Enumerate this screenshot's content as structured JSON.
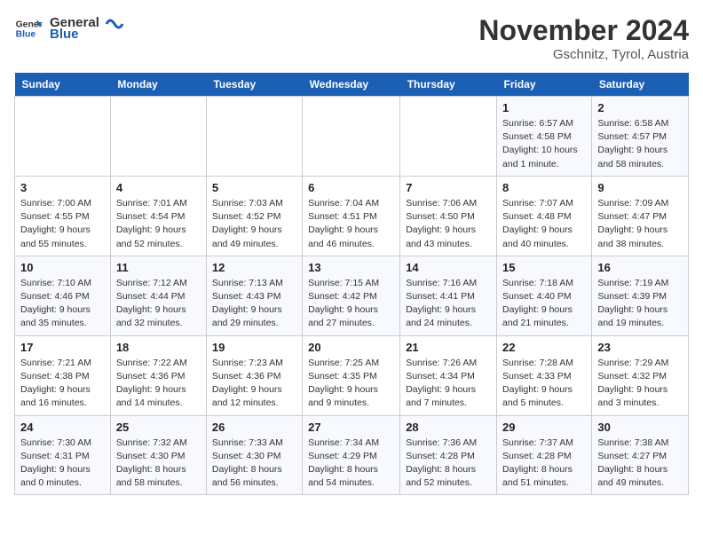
{
  "logo": {
    "text_general": "General",
    "text_blue": "Blue"
  },
  "title": "November 2024",
  "location": "Gschnitz, Tyrol, Austria",
  "weekdays": [
    "Sunday",
    "Monday",
    "Tuesday",
    "Wednesday",
    "Thursday",
    "Friday",
    "Saturday"
  ],
  "weeks": [
    [
      {
        "day": "",
        "info": ""
      },
      {
        "day": "",
        "info": ""
      },
      {
        "day": "",
        "info": ""
      },
      {
        "day": "",
        "info": ""
      },
      {
        "day": "",
        "info": ""
      },
      {
        "day": "1",
        "info": "Sunrise: 6:57 AM\nSunset: 4:58 PM\nDaylight: 10 hours and 1 minute."
      },
      {
        "day": "2",
        "info": "Sunrise: 6:58 AM\nSunset: 4:57 PM\nDaylight: 9 hours and 58 minutes."
      }
    ],
    [
      {
        "day": "3",
        "info": "Sunrise: 7:00 AM\nSunset: 4:55 PM\nDaylight: 9 hours and 55 minutes."
      },
      {
        "day": "4",
        "info": "Sunrise: 7:01 AM\nSunset: 4:54 PM\nDaylight: 9 hours and 52 minutes."
      },
      {
        "day": "5",
        "info": "Sunrise: 7:03 AM\nSunset: 4:52 PM\nDaylight: 9 hours and 49 minutes."
      },
      {
        "day": "6",
        "info": "Sunrise: 7:04 AM\nSunset: 4:51 PM\nDaylight: 9 hours and 46 minutes."
      },
      {
        "day": "7",
        "info": "Sunrise: 7:06 AM\nSunset: 4:50 PM\nDaylight: 9 hours and 43 minutes."
      },
      {
        "day": "8",
        "info": "Sunrise: 7:07 AM\nSunset: 4:48 PM\nDaylight: 9 hours and 40 minutes."
      },
      {
        "day": "9",
        "info": "Sunrise: 7:09 AM\nSunset: 4:47 PM\nDaylight: 9 hours and 38 minutes."
      }
    ],
    [
      {
        "day": "10",
        "info": "Sunrise: 7:10 AM\nSunset: 4:46 PM\nDaylight: 9 hours and 35 minutes."
      },
      {
        "day": "11",
        "info": "Sunrise: 7:12 AM\nSunset: 4:44 PM\nDaylight: 9 hours and 32 minutes."
      },
      {
        "day": "12",
        "info": "Sunrise: 7:13 AM\nSunset: 4:43 PM\nDaylight: 9 hours and 29 minutes."
      },
      {
        "day": "13",
        "info": "Sunrise: 7:15 AM\nSunset: 4:42 PM\nDaylight: 9 hours and 27 minutes."
      },
      {
        "day": "14",
        "info": "Sunrise: 7:16 AM\nSunset: 4:41 PM\nDaylight: 9 hours and 24 minutes."
      },
      {
        "day": "15",
        "info": "Sunrise: 7:18 AM\nSunset: 4:40 PM\nDaylight: 9 hours and 21 minutes."
      },
      {
        "day": "16",
        "info": "Sunrise: 7:19 AM\nSunset: 4:39 PM\nDaylight: 9 hours and 19 minutes."
      }
    ],
    [
      {
        "day": "17",
        "info": "Sunrise: 7:21 AM\nSunset: 4:38 PM\nDaylight: 9 hours and 16 minutes."
      },
      {
        "day": "18",
        "info": "Sunrise: 7:22 AM\nSunset: 4:36 PM\nDaylight: 9 hours and 14 minutes."
      },
      {
        "day": "19",
        "info": "Sunrise: 7:23 AM\nSunset: 4:36 PM\nDaylight: 9 hours and 12 minutes."
      },
      {
        "day": "20",
        "info": "Sunrise: 7:25 AM\nSunset: 4:35 PM\nDaylight: 9 hours and 9 minutes."
      },
      {
        "day": "21",
        "info": "Sunrise: 7:26 AM\nSunset: 4:34 PM\nDaylight: 9 hours and 7 minutes."
      },
      {
        "day": "22",
        "info": "Sunrise: 7:28 AM\nSunset: 4:33 PM\nDaylight: 9 hours and 5 minutes."
      },
      {
        "day": "23",
        "info": "Sunrise: 7:29 AM\nSunset: 4:32 PM\nDaylight: 9 hours and 3 minutes."
      }
    ],
    [
      {
        "day": "24",
        "info": "Sunrise: 7:30 AM\nSunset: 4:31 PM\nDaylight: 9 hours and 0 minutes."
      },
      {
        "day": "25",
        "info": "Sunrise: 7:32 AM\nSunset: 4:30 PM\nDaylight: 8 hours and 58 minutes."
      },
      {
        "day": "26",
        "info": "Sunrise: 7:33 AM\nSunset: 4:30 PM\nDaylight: 8 hours and 56 minutes."
      },
      {
        "day": "27",
        "info": "Sunrise: 7:34 AM\nSunset: 4:29 PM\nDaylight: 8 hours and 54 minutes."
      },
      {
        "day": "28",
        "info": "Sunrise: 7:36 AM\nSunset: 4:28 PM\nDaylight: 8 hours and 52 minutes."
      },
      {
        "day": "29",
        "info": "Sunrise: 7:37 AM\nSunset: 4:28 PM\nDaylight: 8 hours and 51 minutes."
      },
      {
        "day": "30",
        "info": "Sunrise: 7:38 AM\nSunset: 4:27 PM\nDaylight: 8 hours and 49 minutes."
      }
    ]
  ]
}
